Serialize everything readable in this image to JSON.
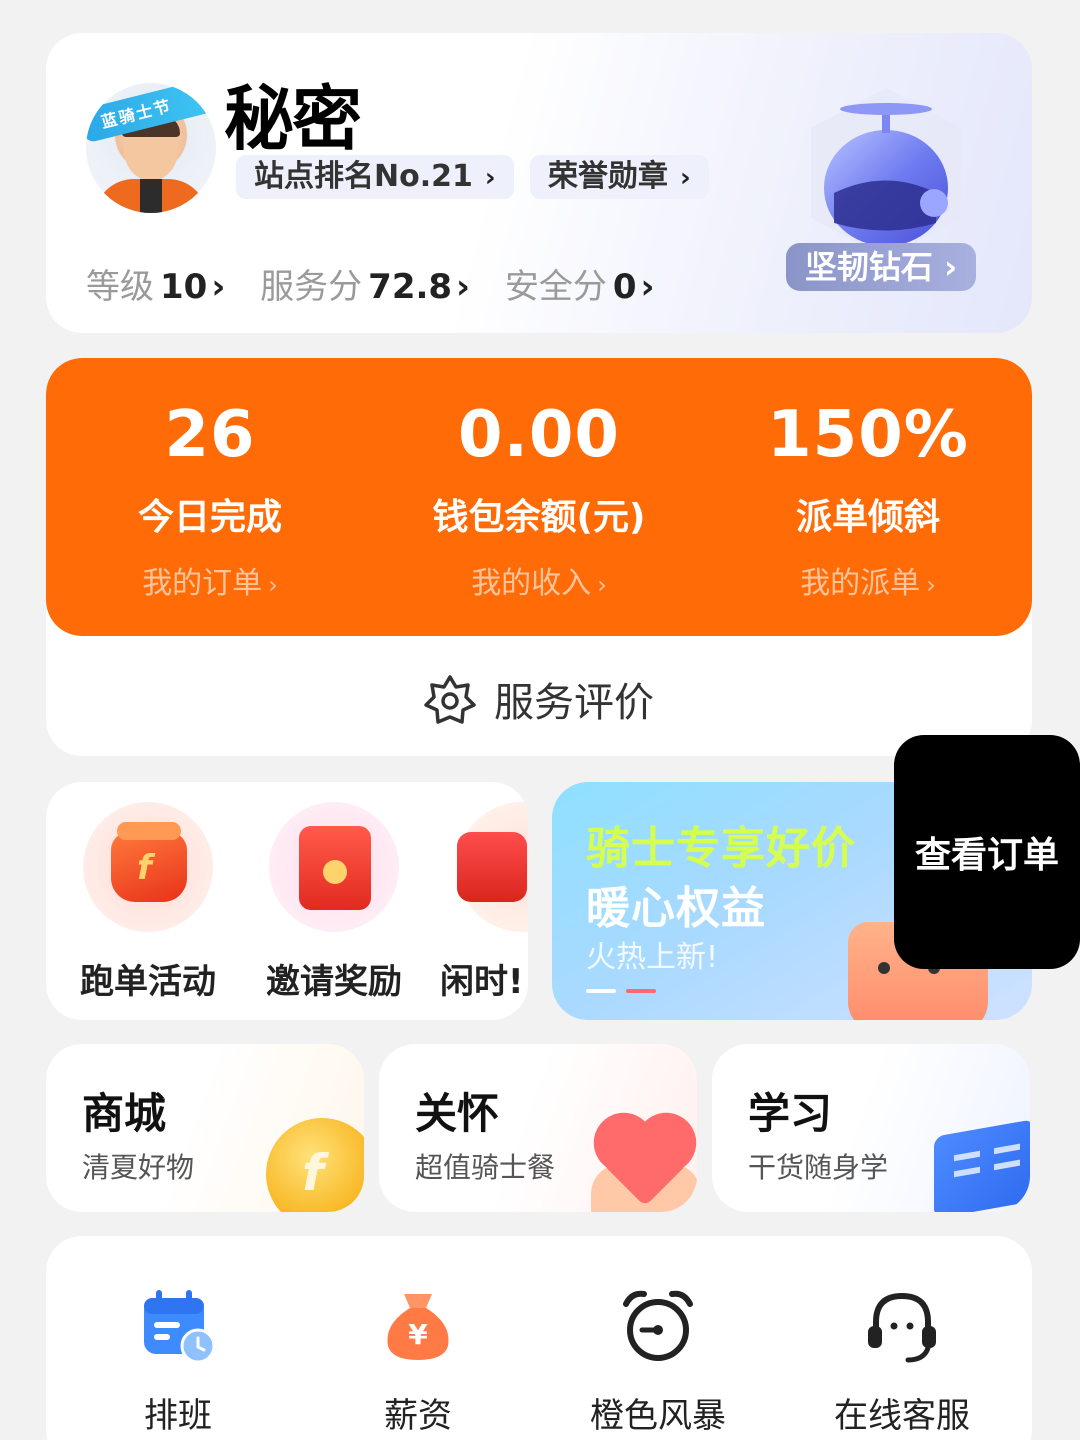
{
  "profile": {
    "nickname": "秘密",
    "avatar_banner": "蓝骑士节",
    "rank_pill": "站点排名No.21",
    "medal_pill": "荣誉勋章",
    "stats": [
      {
        "label": "等级",
        "value": "10"
      },
      {
        "label": "服务分",
        "value": "72.8"
      },
      {
        "label": "安全分",
        "value": "0"
      }
    ],
    "level_badge": "坚韧钻石",
    "chevron": "›"
  },
  "summary": {
    "items": [
      {
        "value": "26",
        "label": "今日完成",
        "link": "我的订单"
      },
      {
        "value": "0.00",
        "label": "钱包余额(元)",
        "link": "我的收入"
      },
      {
        "value": "150%",
        "label": "派单倾斜",
        "link": "我的派单"
      }
    ],
    "accent_color": "#ff6b06",
    "service_eval": "服务评价"
  },
  "activities": [
    {
      "label": "跑单活动",
      "icon": "bag-icon"
    },
    {
      "label": "邀请奖励",
      "icon": "red-envelope-icon"
    },
    {
      "label": "闲时!",
      "icon": "gift-icon"
    }
  ],
  "banner": {
    "line1": "骑士专享好价",
    "line2": "暖心权益",
    "line3": "火热上新!"
  },
  "floating_button": "查看订单",
  "mini_cards": [
    {
      "title": "商城",
      "subtitle": "清夏好物"
    },
    {
      "title": "关怀",
      "subtitle": "超值骑士餐"
    },
    {
      "title": "学习",
      "subtitle": "干货随身学"
    }
  ],
  "tools": [
    {
      "label": "排班",
      "icon": "calendar-icon"
    },
    {
      "label": "薪资",
      "icon": "money-bag-icon"
    },
    {
      "label": "橙色风暴",
      "icon": "alarm-clock-icon"
    },
    {
      "label": "在线客服",
      "icon": "headset-icon"
    }
  ]
}
